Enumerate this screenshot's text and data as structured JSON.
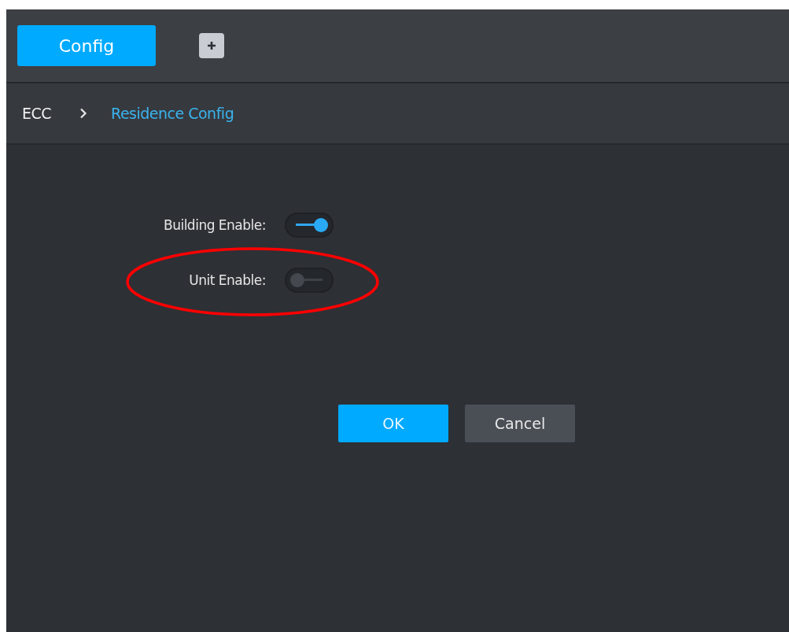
{
  "tabs": [
    {
      "label": "Config",
      "selected": true
    }
  ],
  "breadcrumb": [
    {
      "label": "ECC",
      "current": false
    },
    {
      "label": "Residence Config",
      "current": true
    }
  ],
  "settings": [
    {
      "label": "Building Enable:",
      "on": true
    },
    {
      "label": "Unit Enable:",
      "on": false
    }
  ],
  "buttons": [
    {
      "label": "OK",
      "kind": "primary"
    },
    {
      "label": "Cancel",
      "kind": "secondary"
    }
  ]
}
